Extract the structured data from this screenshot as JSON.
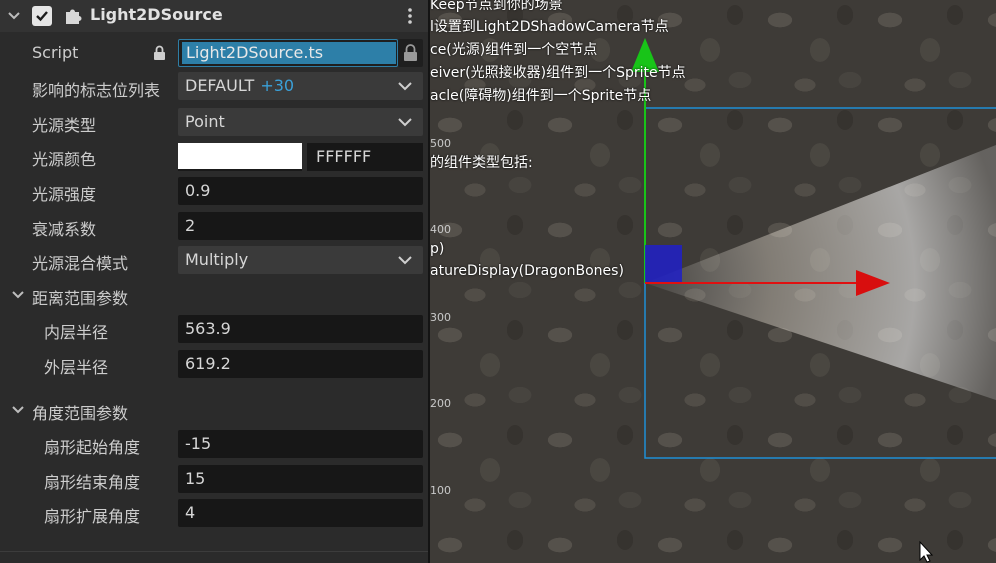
{
  "component": {
    "title": "Light2DSource",
    "enabled": true
  },
  "properties": {
    "script_label": "Script",
    "script_value": "Light2DSource.ts",
    "flags_label": "影响的标志位列表",
    "flags_value": "DEFAULT",
    "flags_extra": "+30",
    "type_label": "光源类型",
    "type_value": "Point",
    "color_label": "光源颜色",
    "color_hex": "FFFFFF",
    "intensity_label": "光源强度",
    "intensity_value": "0.9",
    "falloff_label": "衰减系数",
    "falloff_value": "2",
    "blend_label": "光源混合模式",
    "blend_value": "Multiply"
  },
  "range_group": {
    "title": "距离范围参数",
    "inner_label": "内层半径",
    "inner_value": "563.9",
    "outer_label": "外层半径",
    "outer_value": "619.2"
  },
  "angle_group": {
    "title": "角度范围参数",
    "start_label": "扇形起始角度",
    "start_value": "-15",
    "end_label": "扇形结束角度",
    "end_value": "15",
    "spread_label": "扇形扩展角度",
    "spread_value": "4"
  },
  "scene": {
    "text_lines": [
      "Keep节点到你的场景",
      "l设置到Light2DShadowCamera节点",
      "ce(光源)组件到一个空节点",
      "eiver(光照接收器)组件到一个Sprite节点",
      "acle(障碍物)组件到一个Sprite节点",
      "的组件类型包括:",
      "p)",
      "atureDisplay(DragonBones)"
    ],
    "axis_labels": [
      "500",
      "400",
      "300",
      "200",
      "100"
    ]
  },
  "colors": {
    "accent": "#3aa0d8",
    "script_highlight": "#2d7fa8",
    "selection_rect": "#1e8fd6",
    "gizmo_x": "#e01010",
    "gizmo_y": "#18c418",
    "gizmo_center": "#2020c8"
  }
}
